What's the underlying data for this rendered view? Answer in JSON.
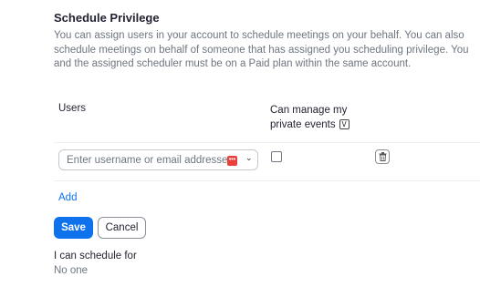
{
  "section": {
    "title": "Schedule Privilege",
    "description": "You can assign users in your account to schedule meetings on your behalf. You can also schedule meetings on behalf of someone that has assigned you scheduling privilege. You and the assigned scheduler must be on a Paid plan within the same account."
  },
  "table": {
    "headers": {
      "users": "Users",
      "manage_line1": "Can manage my",
      "manage_line2": "private events",
      "manage_icon": "v-icon"
    },
    "row": {
      "user_input_placeholder": "Enter username or email addresses",
      "user_input_value": "",
      "private_events_checked": false,
      "extension_icon": "password-manager-icon",
      "delete_icon": "trash-icon"
    }
  },
  "actions": {
    "add_label": "Add",
    "save_label": "Save",
    "cancel_label": "Cancel"
  },
  "can_schedule": {
    "label": "I can schedule for",
    "value": "No one"
  },
  "colors": {
    "primary": "#0e72ed",
    "text": "#232333",
    "muted": "#6e7680",
    "extension_badge": "#e8413c"
  }
}
